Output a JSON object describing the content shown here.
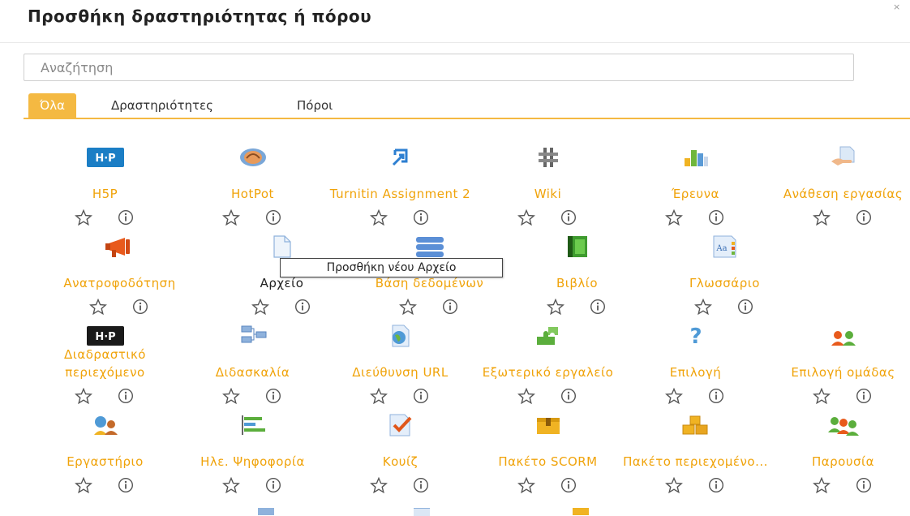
{
  "dialog": {
    "title": "Προσθήκη δραστηριότητας ή πόρου"
  },
  "search": {
    "placeholder": "Αναζήτηση"
  },
  "tabs": [
    {
      "label": "Όλα",
      "active": true
    },
    {
      "label": "Δραστηριότητες"
    },
    {
      "label": "Πόροι"
    }
  ],
  "tooltip": "Προσθήκη νέου Αρχείο",
  "rows": [
    [
      {
        "label": "H5P",
        "icon": "h5p-icon"
      },
      {
        "label": "HotPot",
        "icon": "hotpot-icon"
      },
      {
        "label": "Turnitin Assignment 2",
        "icon": "turnitin-icon"
      },
      {
        "label": "Wiki",
        "icon": "wiki-icon"
      },
      {
        "label": "Έρευνα",
        "icon": "survey-icon"
      },
      {
        "label": "Ανάθεση εργασίας",
        "icon": "assignment-icon"
      }
    ],
    [
      {
        "label": "Ανατροφοδότηση",
        "icon": "feedback-icon"
      },
      {
        "label": "Αρχείο",
        "icon": "file-icon",
        "hovered": true
      },
      {
        "label": "Βάση δεδομένων",
        "icon": "database-icon"
      },
      {
        "label": "Βιβλίο",
        "icon": "book-icon"
      },
      {
        "label": "Γλωσσάριο",
        "icon": "glossary-icon"
      }
    ],
    [
      {
        "label": "Διαδραστικό περιεχόμενο",
        "icon": "h5p-icon"
      },
      {
        "label": "Διδασκαλία",
        "icon": "lesson-icon"
      },
      {
        "label": "Διεύθυνση URL",
        "icon": "url-icon"
      },
      {
        "label": "Εξωτερικό εργαλείο",
        "icon": "external-tool-icon"
      },
      {
        "label": "Επιλογή",
        "icon": "choice-icon"
      },
      {
        "label": "Επιλογή ομάδας",
        "icon": "group-choice-icon"
      }
    ],
    [
      {
        "label": "Εργαστήριο",
        "icon": "workshop-icon"
      },
      {
        "label": "Ηλε. Ψηφοφορία",
        "icon": "vote-icon"
      },
      {
        "label": "Κουίζ",
        "icon": "quiz-icon"
      },
      {
        "label": "Πακέτο SCORM",
        "icon": "scorm-icon"
      },
      {
        "label": "Πακέτο περιεχομένο...",
        "icon": "content-package-icon"
      },
      {
        "label": "Παρουσία",
        "icon": "attendance-icon"
      }
    ]
  ],
  "colors": {
    "accent": "#f4b942",
    "link": "#f0a30a"
  }
}
